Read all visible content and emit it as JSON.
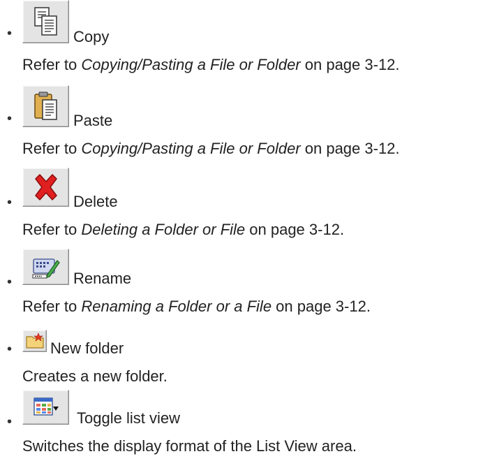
{
  "items": [
    {
      "icon": "copy-icon",
      "label": "Copy",
      "ref_prefix": "Refer to ",
      "ref_title": "Copying/Pasting a File or Folder",
      "ref_suffix": " on page 3-12."
    },
    {
      "icon": "paste-icon",
      "label": "Paste",
      "ref_prefix": "Refer to ",
      "ref_title": "Copying/Pasting a File or Folder",
      "ref_suffix": " on page 3-12."
    },
    {
      "icon": "delete-icon",
      "label": "Delete",
      "ref_prefix": "Refer to ",
      "ref_title": "Deleting a Folder or File",
      "ref_suffix": " on page 3-12."
    },
    {
      "icon": "rename-icon",
      "label": "Rename",
      "ref_prefix": "Refer to ",
      "ref_title": "Renaming a Folder or a File",
      "ref_suffix": " on page 3-12."
    },
    {
      "icon": "new-folder-icon",
      "label": "New folder",
      "description": "Creates a new folder."
    },
    {
      "icon": "toggle-list-view-icon",
      "label": "Toggle list view",
      "description": "Switches the display format of the List View area."
    }
  ],
  "bullet": "•"
}
